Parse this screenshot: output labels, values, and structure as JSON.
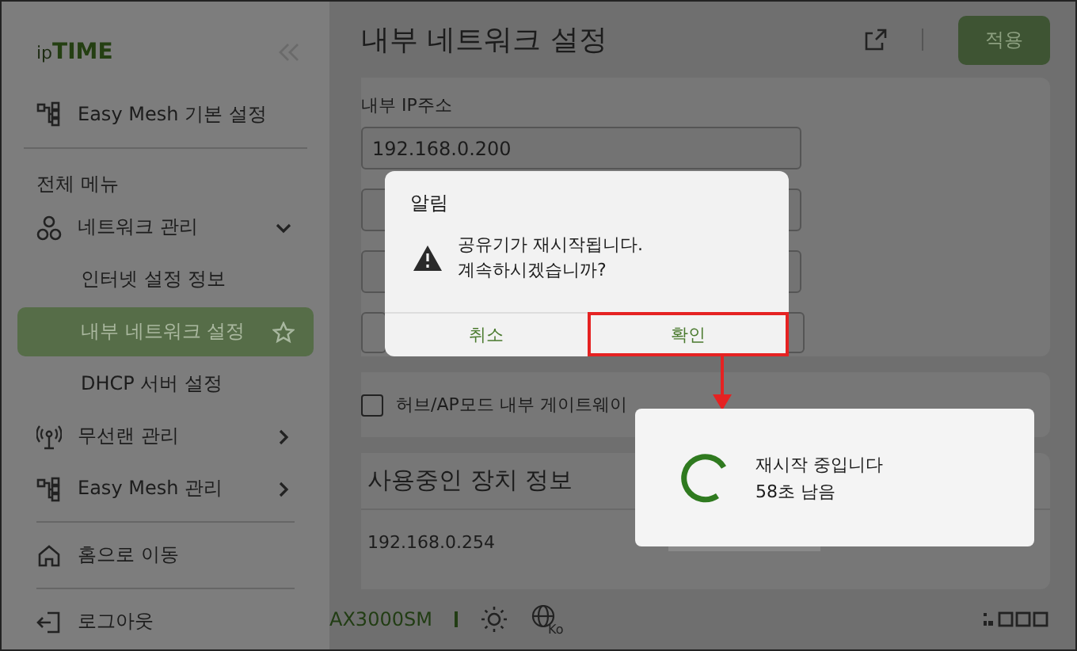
{
  "sidebar": {
    "logo": {
      "prefix": "ip",
      "brand": "TIME"
    },
    "top_item": "Easy Mesh 기본 설정",
    "section": "전체 메뉴",
    "items": [
      {
        "label": "네트워크 관리",
        "kind": "network",
        "expanded": true,
        "children": [
          {
            "label": "인터넷 설정 정보",
            "selected": false
          },
          {
            "label": "내부 네트워크 설정",
            "selected": true
          },
          {
            "label": "DHCP 서버 설정",
            "selected": false
          }
        ]
      },
      {
        "label": "무선랜 관리",
        "kind": "wireless",
        "expanded": false
      },
      {
        "label": "Easy Mesh 관리",
        "kind": "mesh",
        "expanded": false
      }
    ],
    "home": "홈으로 이동",
    "logout": "로그아웃"
  },
  "header": {
    "title": "내부 네트워크 설정",
    "apply_button": "적용"
  },
  "form": {
    "ip_label": "내부 IP주소",
    "ip_value": "192.168.0.200"
  },
  "hub_option": {
    "label": "허브/AP모드 내부 게이트웨이",
    "checked": false
  },
  "devices": {
    "title": "사용중인 장치 정보",
    "rows": [
      {
        "ip": "192.168.0.254"
      }
    ]
  },
  "footer": {
    "model": "AX3000SM",
    "language_badge": "Ko"
  },
  "dialog": {
    "title": "알림",
    "message_lines": [
      "공유기가 재시작됩니다.",
      "계속하시겠습니까?"
    ],
    "buttons": [
      {
        "label": "취소",
        "highlighted": false
      },
      {
        "label": "확인",
        "highlighted": true
      }
    ]
  },
  "progress": {
    "lines": [
      "재시작 중입니다",
      "58초 남음"
    ]
  }
}
